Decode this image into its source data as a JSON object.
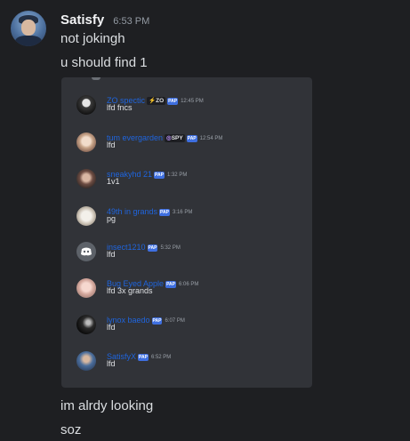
{
  "message": {
    "author": "Satisfy",
    "timestamp": "6:53 PM",
    "lines_before": [
      "not jokingh",
      "u should find 1"
    ],
    "lines_after": [
      "im alrdy looking",
      "soz"
    ]
  },
  "embed": {
    "messages": [
      {
        "name": "ZO spectic",
        "tag": "ZO",
        "badge": "PAP",
        "time": "12:45 PM",
        "text": "lfd fncs",
        "avatar_icon": "dark-avatar-icon"
      },
      {
        "name": "tum evergarden",
        "tag": "SPY",
        "badge": "PAP",
        "time": "12:54 PM",
        "text": "lfd",
        "avatar_icon": "anime-avatar-icon"
      },
      {
        "name": "sneakyhd 21",
        "tag": "",
        "badge": "PAP",
        "time": "1:32 PM",
        "text": "1v1",
        "avatar_icon": "portrait-avatar-icon"
      },
      {
        "name": "49th in grands",
        "tag": "",
        "badge": "PAP",
        "time": "3:16 PM",
        "text": "pg",
        "avatar_icon": "dog-avatar-icon"
      },
      {
        "name": "insect1210",
        "tag": "",
        "badge": "PAP",
        "time": "5:32 PM",
        "text": "lfd",
        "avatar_icon": "discord-default-avatar-icon"
      },
      {
        "name": "Bug Eyed Apple",
        "tag": "",
        "badge": "PAP",
        "time": "6:06 PM",
        "text": "lfd 3x grands",
        "avatar_icon": "pink-avatar-icon"
      },
      {
        "name": "lynox baedo",
        "tag": "",
        "badge": "PAP",
        "time": "6:07 PM",
        "text": "lfd",
        "avatar_icon": "black-avatar-icon"
      },
      {
        "name": "SatisfyX",
        "tag": "",
        "badge": "PAP",
        "time": "6:52 PM",
        "text": "lfd",
        "avatar_icon": "blue-avatar-icon"
      }
    ]
  },
  "colors": {
    "background": "#1e1f22",
    "embed_background": "#313338",
    "embed_name": "#1f65de",
    "badge": "#3e6fe0"
  }
}
